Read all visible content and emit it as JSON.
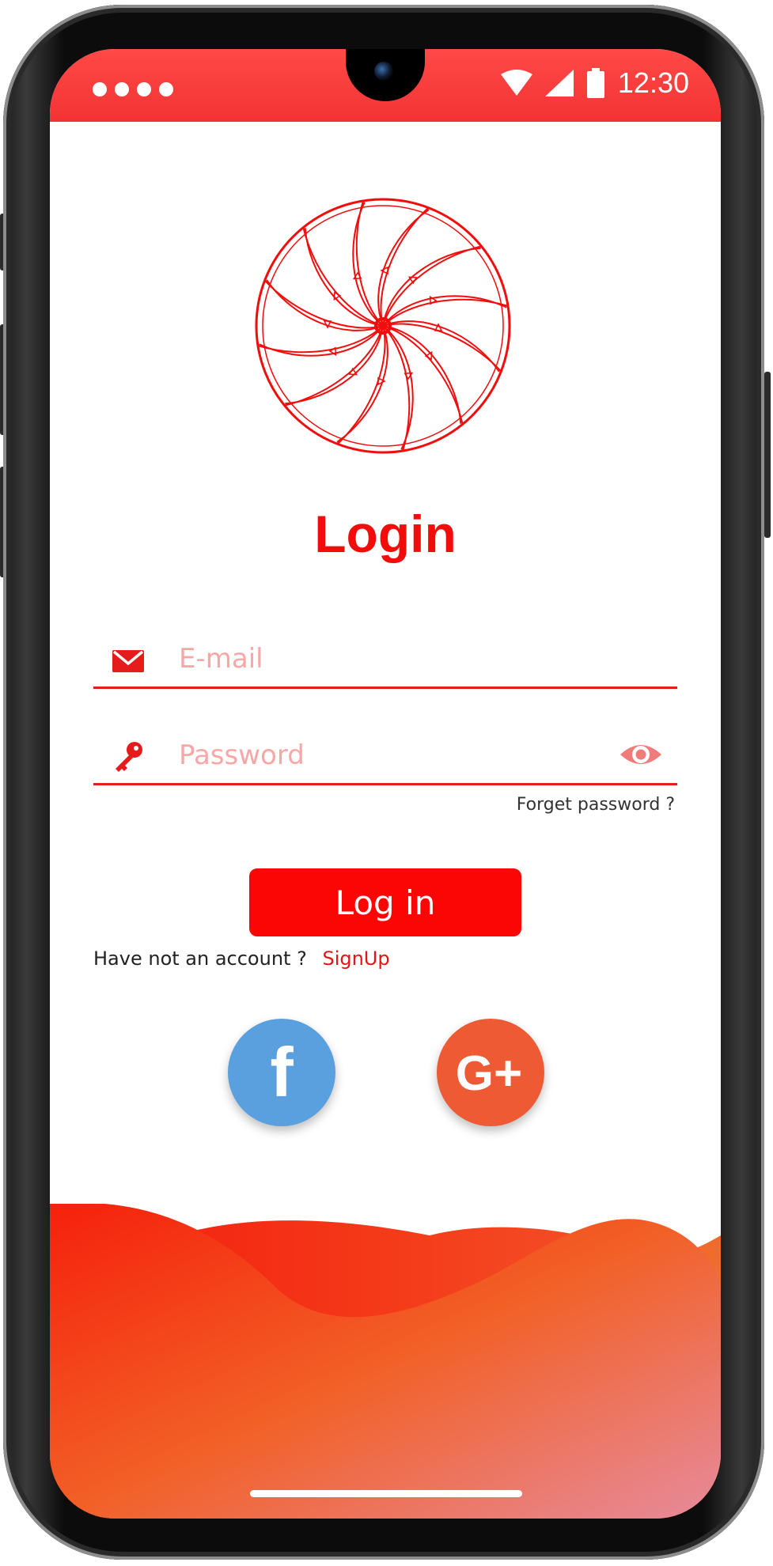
{
  "status_bar": {
    "time": "12:30",
    "icons": [
      "signal-dots-icon",
      "wifi-icon",
      "cell-signal-icon",
      "battery-icon"
    ]
  },
  "login": {
    "title": "Login",
    "email_placeholder": "E-mail",
    "email_value": "",
    "password_placeholder": "Password",
    "password_value": "",
    "forgot_label": "Forget password ?",
    "submit_label": "Log in",
    "no_account_text": "Have not an account ?",
    "signup_label": "SignUp"
  },
  "social": {
    "facebook_label": "f",
    "google_label": "G+"
  },
  "colors": {
    "accent": "#f20d0d",
    "button": "#fb0505",
    "facebook": "#5a9fde",
    "google": "#ee5a33",
    "placeholder": "#f8a6a6"
  }
}
